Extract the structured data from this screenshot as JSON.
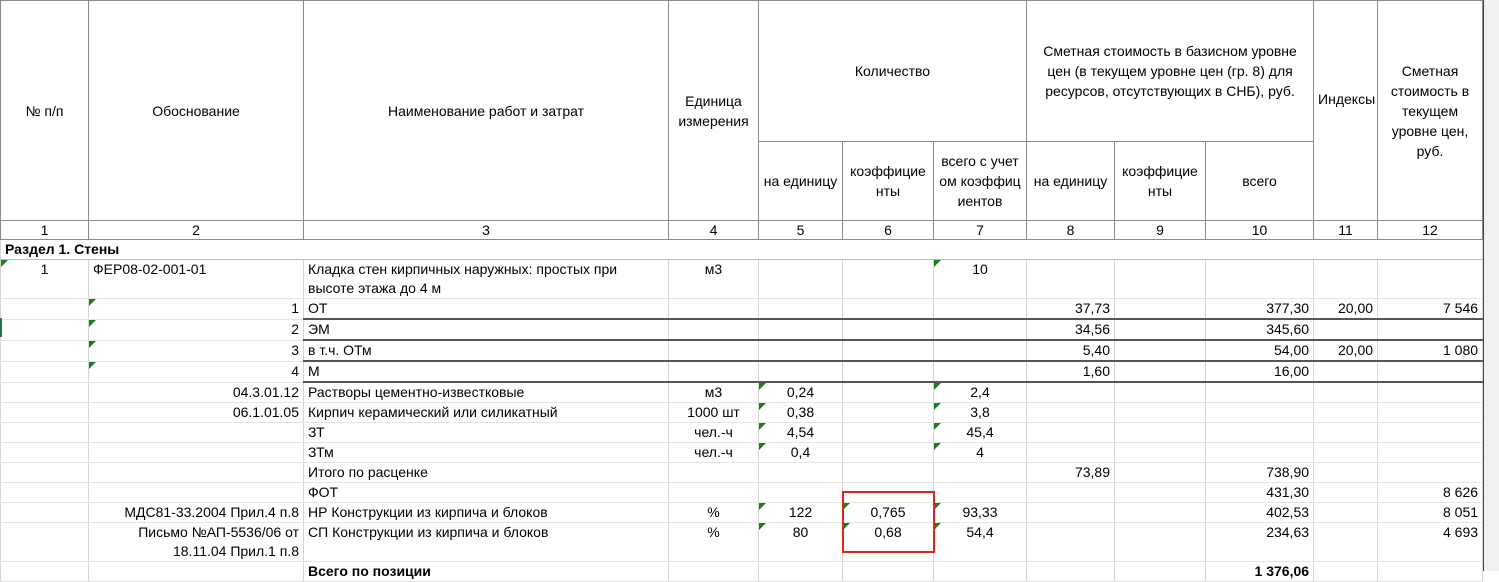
{
  "header": {
    "col1": "№ п/п",
    "col2": "Обоснование",
    "col3": "Наименование работ и затрат",
    "col4": "Единица измерения",
    "quantity": "Количество",
    "q_per_unit": "на единицу",
    "q_coef": "коэффициенты",
    "q_total": "всего с учетом коэффициентов",
    "cost_group": "Сметная стоимость в базисном уровне цен (в текущем уровне цен (гр. 8) для ресурсов, отсутствующих в СНБ), руб.",
    "c_per_unit": "на единицу",
    "c_coef": "коэффициенты",
    "c_total": "всего",
    "col11": "Индексы",
    "col12": "Сметная стоимость в текущем уровне цен, руб.",
    "numbers": [
      "1",
      "2",
      "3",
      "4",
      "5",
      "6",
      "7",
      "8",
      "9",
      "10",
      "11",
      "12"
    ]
  },
  "section": "Раздел 1. Стены",
  "rows": [
    {
      "cells": [
        "1",
        "ФЕР08-02-001-01",
        "Кладка стен кирпичных наружных: простых при высоте этажа до 4 м",
        "м3",
        "",
        "",
        "10",
        "",
        "",
        "",
        "",
        ""
      ],
      "markers": [
        0,
        6
      ],
      "tall": true,
      "leftcol2": true
    },
    {
      "cells": [
        "",
        "1",
        "ОТ",
        "",
        "",
        "",
        "",
        "37,73",
        "",
        "377,30",
        "20,00",
        "7 546"
      ],
      "markers": [
        1
      ],
      "thick": true
    },
    {
      "cells": [
        "",
        "2",
        "ЭМ",
        "",
        "",
        "",
        "",
        "34,56",
        "",
        "345,60",
        "",
        ""
      ],
      "markers": [
        1
      ],
      "thick": true
    },
    {
      "cells": [
        "",
        "3",
        "в т.ч. ОТм",
        "",
        "",
        "",
        "",
        "5,40",
        "",
        "54,00",
        "20,00",
        "1 080"
      ],
      "markers": [
        1
      ],
      "thick": true
    },
    {
      "cells": [
        "",
        "4",
        "М",
        "",
        "",
        "",
        "",
        "1,60",
        "",
        "16,00",
        "",
        ""
      ],
      "markers": [
        1
      ],
      "thick": true
    },
    {
      "cells": [
        "",
        "04.3.01.12",
        "Растворы цементно-известковые",
        "м3",
        "0,24",
        "",
        "2,4",
        "",
        "",
        "",
        "",
        ""
      ],
      "markers": [
        4,
        6
      ]
    },
    {
      "cells": [
        "",
        "06.1.01.05",
        "Кирпич керамический или силикатный",
        "1000 шт",
        "0,38",
        "",
        "3,8",
        "",
        "",
        "",
        "",
        ""
      ],
      "markers": [
        4,
        6
      ]
    },
    {
      "cells": [
        "",
        "",
        "ЗТ",
        "чел.-ч",
        "4,54",
        "",
        "45,4",
        "",
        "",
        "",
        "",
        ""
      ],
      "markers": [
        4,
        6
      ]
    },
    {
      "cells": [
        "",
        "",
        "ЗТм",
        "чел.-ч",
        "0,4",
        "",
        "4",
        "",
        "",
        "",
        "",
        ""
      ],
      "markers": [
        4,
        6
      ]
    },
    {
      "cells": [
        "",
        "",
        "Итого по расценке",
        "",
        "",
        "",
        "",
        "73,89",
        "",
        "738,90",
        "",
        ""
      ],
      "markers": []
    },
    {
      "cells": [
        "",
        "",
        "ФОТ",
        "",
        "",
        "",
        "",
        "",
        "",
        "431,30",
        "",
        "8 626"
      ],
      "markers": []
    },
    {
      "cells": [
        "",
        "МДС81-33.2004 Прил.4 п.8",
        "НР Конструкции из кирпича и блоков",
        "%",
        "122",
        "0,765",
        "93,33",
        "",
        "",
        "402,53",
        "",
        "8 051"
      ],
      "markers": [
        4,
        5,
        6
      ]
    },
    {
      "cells": [
        "",
        "Письмо №АП-5536/06 от 18.11.04 Прил.1 п.8",
        "СП Конструкции из кирпича и блоков",
        "%",
        "80",
        "0,68",
        "54,4",
        "",
        "",
        "234,63",
        "",
        "4 693"
      ],
      "markers": [
        4,
        5,
        6
      ],
      "tall": true
    },
    {
      "cells": [
        "",
        "",
        "Всего по позиции",
        "",
        "",
        "",
        "",
        "",
        "",
        "1 376,06",
        "",
        ""
      ],
      "markers": [],
      "bold": true
    }
  ],
  "colors": {
    "marker": "#1a7f1a",
    "highlight": "#e2231a"
  }
}
